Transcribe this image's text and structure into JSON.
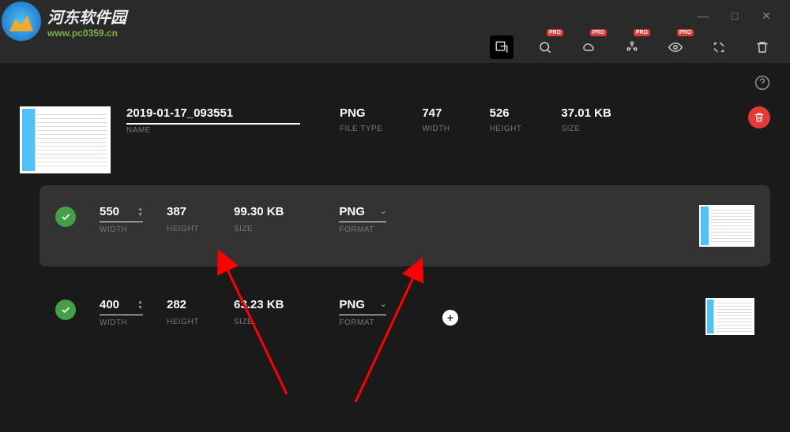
{
  "watermark": {
    "title": "河东软件园",
    "url": "www.pc0359.cn"
  },
  "window_controls": {
    "minimize": "—",
    "maximize": "□",
    "close": "✕"
  },
  "toolbar": {
    "pro_label": "PRO"
  },
  "file": {
    "name": "2019-01-17_093551",
    "name_label": "NAME",
    "filetype": "PNG",
    "filetype_label": "FILE TYPE",
    "width": "747",
    "width_label": "WIDTH",
    "height": "526",
    "height_label": "HEIGHT",
    "size": "37.01 KB",
    "size_label": "SIZE"
  },
  "variants": [
    {
      "width": "550",
      "width_label": "WIDTH",
      "height": "387",
      "height_label": "HEIGHT",
      "size": "99.30 KB",
      "size_label": "SIZE",
      "format": "PNG",
      "format_label": "FORMAT",
      "highlighted": true
    },
    {
      "width": "400",
      "width_label": "WIDTH",
      "height": "282",
      "height_label": "HEIGHT",
      "size": "63.23 KB",
      "size_label": "SIZE",
      "format": "PNG",
      "format_label": "FORMAT",
      "highlighted": false
    }
  ],
  "add_label": "+"
}
